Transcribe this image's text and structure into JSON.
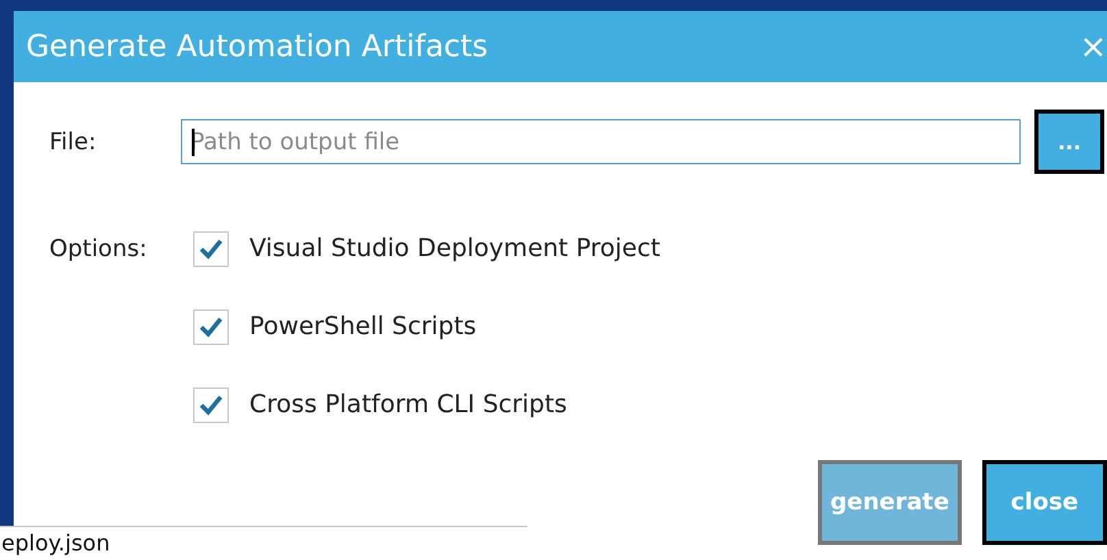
{
  "window": {
    "title": "Generate Automation Artifacts",
    "close": "×"
  },
  "file": {
    "label": "File:",
    "placeholder": "Path to output file",
    "browse": "..."
  },
  "options": {
    "label": "Options:",
    "items": [
      {
        "label": "Visual Studio Deployment Project",
        "checked": true
      },
      {
        "label": "PowerShell Scripts",
        "checked": true
      },
      {
        "label": "Cross Platform CLI Scripts",
        "checked": true
      }
    ]
  },
  "buttons": [
    {
      "label": "generate",
      "disabled": true
    },
    {
      "label": "close",
      "disabled": false
    }
  ],
  "background_window": {
    "text": "eploy.json"
  }
}
